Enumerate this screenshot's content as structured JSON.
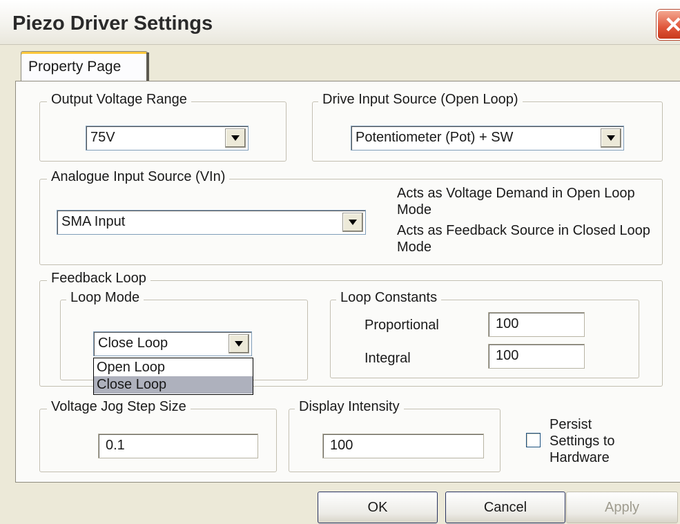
{
  "window": {
    "title": "Piezo Driver Settings"
  },
  "tabs": [
    {
      "label": "Property Page"
    }
  ],
  "output_voltage": {
    "legend": "Output Voltage Range",
    "selected": "75V"
  },
  "drive_input": {
    "legend": "Drive Input Source (Open Loop)",
    "selected": "Potentiometer (Pot) + SW"
  },
  "analogue_input": {
    "legend": "Analogue Input Source (VIn)",
    "selected": "SMA Input",
    "note_open": "Acts as Voltage Demand in Open Loop Mode",
    "note_closed": "Acts as Feedback Source in Closed Loop Mode"
  },
  "feedback_loop": {
    "legend": "Feedback Loop",
    "loop_mode": {
      "legend": "Loop Mode",
      "selected": "Close Loop",
      "options": [
        "Open Loop",
        "Close Loop"
      ],
      "highlighted_index": 1
    },
    "loop_constants": {
      "legend": "Loop Constants",
      "proportional_label": "Proportional",
      "proportional_value": "100",
      "integral_label": "Integral",
      "integral_value": "100"
    }
  },
  "jog_step": {
    "legend": "Voltage Jog Step Size",
    "value": "0.1"
  },
  "display_intensity": {
    "legend": "Display Intensity",
    "value": "100"
  },
  "persist": {
    "label_line1": "Persist",
    "label_line2": "Settings to",
    "label_line3": "Hardware",
    "checked": false
  },
  "buttons": {
    "ok": "OK",
    "cancel": "Cancel",
    "apply": "Apply"
  },
  "colors": {
    "dialog_bg": "#ece9d8",
    "highlight": "#aeb1bd",
    "close_button": "#e0563a"
  }
}
